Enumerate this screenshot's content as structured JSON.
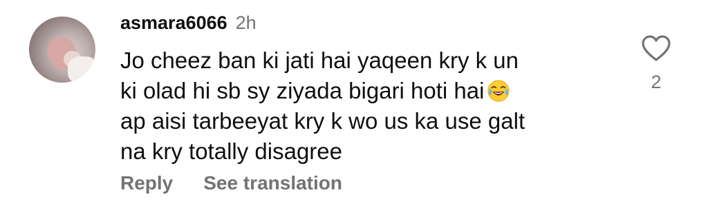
{
  "comment": {
    "username": "asmara6066",
    "timestamp": "2h",
    "text_lines": [
      "Jo cheez ban ki jati hai yaqeen kry k un",
      "ki olad hi sb sy ziyada bigari hoti hai",
      "ap aisi tarbeeyat kry k wo us ka use galt",
      "na kry totally disagree"
    ],
    "emoji": "face-with-tears-of-joy",
    "like_icon": "heart-outline-icon",
    "like_count": "2",
    "actions": {
      "reply": "Reply",
      "see_translation": "See translation"
    }
  },
  "colors": {
    "text_primary": "#0f0f0f",
    "text_secondary": "#737373",
    "background": "#ffffff"
  }
}
